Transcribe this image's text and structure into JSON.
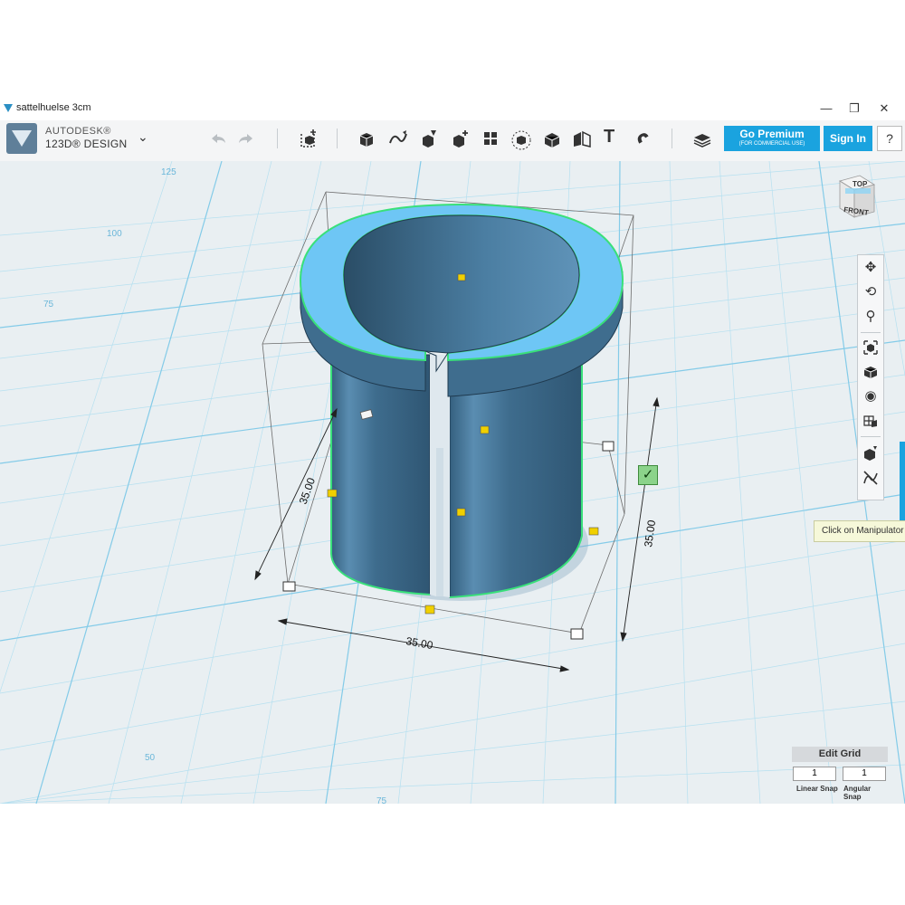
{
  "window": {
    "title": "sattelhuelse 3cm",
    "minimize": "—",
    "restore": "❐",
    "close": "✕"
  },
  "brand": {
    "line1": "AUTODESK®",
    "line2": "123D® DESIGN",
    "menu_icon": "chevron-down-icon"
  },
  "toolbar": {
    "undo_icon": "undo-icon",
    "redo_icon": "redo-icon",
    "text_tool_glyph": "T",
    "premium_label": "Go Premium",
    "premium_sub": "(FOR COMMERCIAL USE)",
    "signin_label": "Sign In",
    "help_label": "?"
  },
  "viewcube": {
    "top_label": "TOP",
    "front_label": "FRONT"
  },
  "grid_ruler": {
    "labels": [
      "125",
      "100",
      "75",
      "50",
      "75"
    ]
  },
  "dimensions": {
    "depth": "35.00",
    "width": "35.00",
    "height": "35.00"
  },
  "tooltip": {
    "text": "Click on Manipulator a"
  },
  "edit_grid": {
    "title": "Edit Grid",
    "linear_value": "1",
    "angular_value": "1",
    "linear_label": "Linear Snap",
    "angular_label": "Angular Snap"
  },
  "colors": {
    "accent": "#1aa3df",
    "model_body": "#3f6d8e",
    "model_top": "#6ec6f5",
    "grid_line": "#8fd0ea",
    "selection_outline": "#39e07a"
  }
}
